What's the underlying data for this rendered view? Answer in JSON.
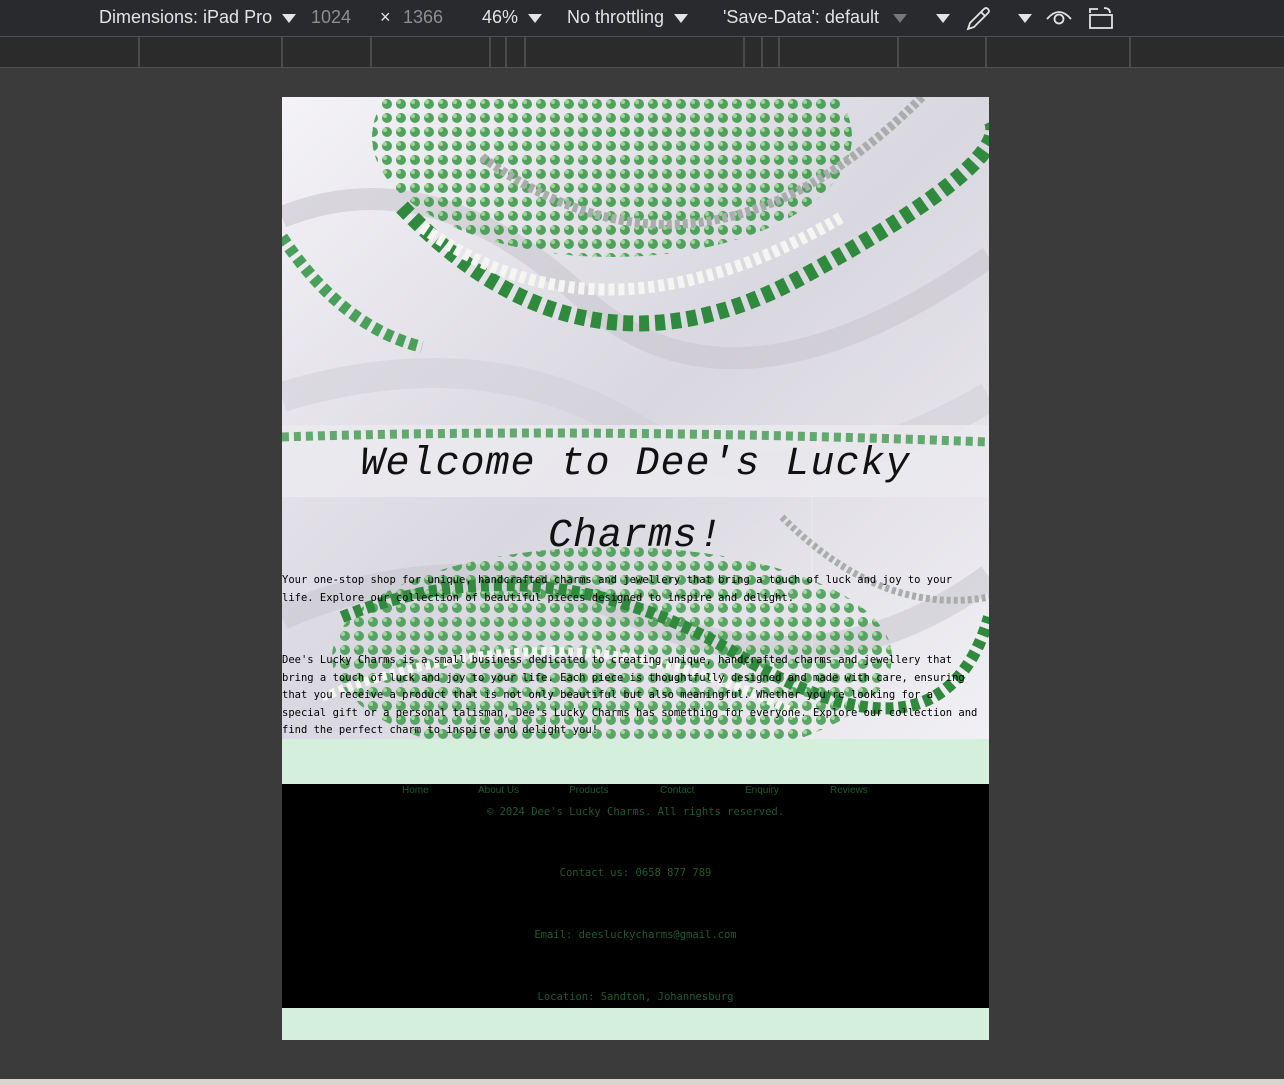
{
  "devtools": {
    "dimensions_label": "Dimensions: iPad Pro",
    "width_value": "1024",
    "times_symbol": "×",
    "height_value": "1366",
    "zoom": "46%",
    "throttling": "No throttling",
    "save_data": "'Save-Data': default"
  },
  "page": {
    "hero_title": "Welcome to Dee's Lucky Charms!",
    "intro": "Your one-stop shop for unique, handcrafted charms and jewellery that bring a touch of luck and joy to your life. Explore our collection of beautiful pieces designed to inspire and delight.",
    "about": "Dee's Lucky Charms is a small business dedicated to creating unique, handcrafted charms and jewellery that bring a touch of luck and joy to your life. Each piece is thoughtfully designed and made with care, ensuring that you receive a product that is not only beautiful but also meaningful. Whether you're looking for a special gift or a personal talisman, Dee's Lucky Charms has something for everyone. Explore our collection and find the perfect charm to inspire and delight you!"
  },
  "footer": {
    "nav": [
      "Home",
      "About Us",
      "Products",
      "Contact",
      "Enquiry",
      "Reviews"
    ],
    "copyright": "© 2024 Dee's Lucky Charms. All rights reserved.",
    "contact": "Contact us: 0658 877 789",
    "email": "Email: deesluckycharms@gmail.com",
    "location": "Location: Sandton, Johannesburg"
  },
  "colors": {
    "mint": "#d4f0dc",
    "footer_text": "#1f5a2c",
    "bead_green": "#3f9a4d"
  },
  "icons": [
    "caret-down-icon",
    "eyedropper-icon",
    "eye-icon",
    "rotate-icon"
  ]
}
